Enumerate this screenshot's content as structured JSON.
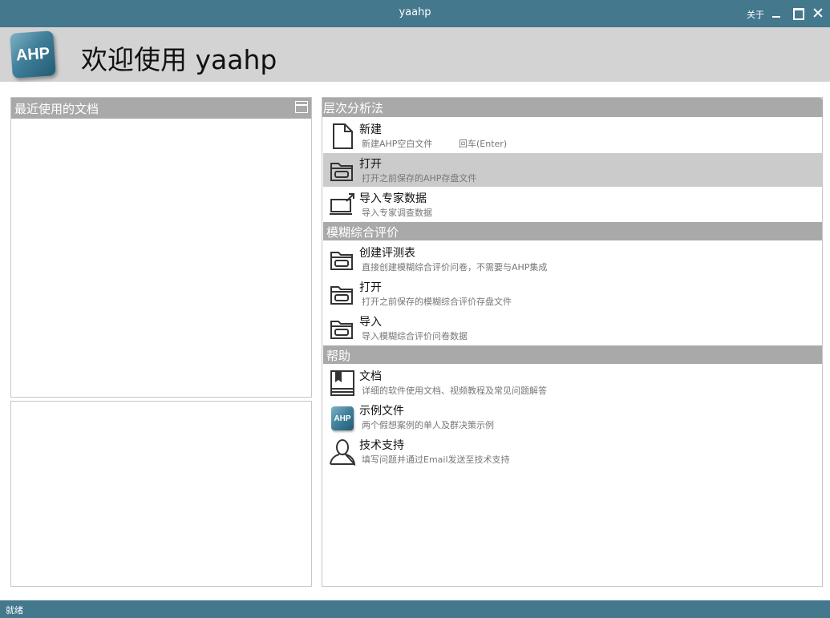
{
  "window": {
    "title": "yaahp",
    "about_label": "关于"
  },
  "header": {
    "logo_text": "AHP",
    "welcome": "欢迎使用 yaahp"
  },
  "recent": {
    "title": "最近使用的文档"
  },
  "ahp": {
    "title": "层次分析法",
    "items": [
      {
        "label": "新建",
        "desc": "新建AHP空白文件",
        "hint": "回车(Enter)",
        "icon": "new-document-icon"
      },
      {
        "label": "打开",
        "desc": "打开之前保存的AHP存盘文件",
        "icon": "open-folder-icon",
        "selected": true
      },
      {
        "label": "导入专家数据",
        "desc": "导入专家调查数据",
        "icon": "import-monitor-icon"
      }
    ]
  },
  "fuzzy": {
    "title": "模糊综合评价",
    "items": [
      {
        "label": "创建评测表",
        "desc": "直接创建模糊综合评价问卷，不需要与AHP集成",
        "icon": "open-folder-icon"
      },
      {
        "label": "打开",
        "desc": "打开之前保存的模糊综合评价存盘文件",
        "icon": "open-folder-icon"
      },
      {
        "label": "导入",
        "desc": "导入模糊综合评价问卷数据",
        "icon": "open-folder-icon"
      }
    ]
  },
  "help": {
    "title": "帮助",
    "items": [
      {
        "label": "文档",
        "desc": "详细的软件使用文档、视频教程及常见问题解答",
        "icon": "book-icon"
      },
      {
        "label": "示例文件",
        "desc": "两个假想案例的单人及群决策示例",
        "icon": "ahp-logo-icon",
        "logo_text": "AHP"
      },
      {
        "label": "技术支持",
        "desc": "填写问题并通过Email发送至技术支持",
        "icon": "user-icon"
      }
    ]
  },
  "status": {
    "text": "就绪"
  },
  "colors": {
    "titlebar": "#43788d",
    "header_bg": "#d3d3d3",
    "section_header": "#a9a9a9",
    "selected_row": "#cbcbcb"
  }
}
